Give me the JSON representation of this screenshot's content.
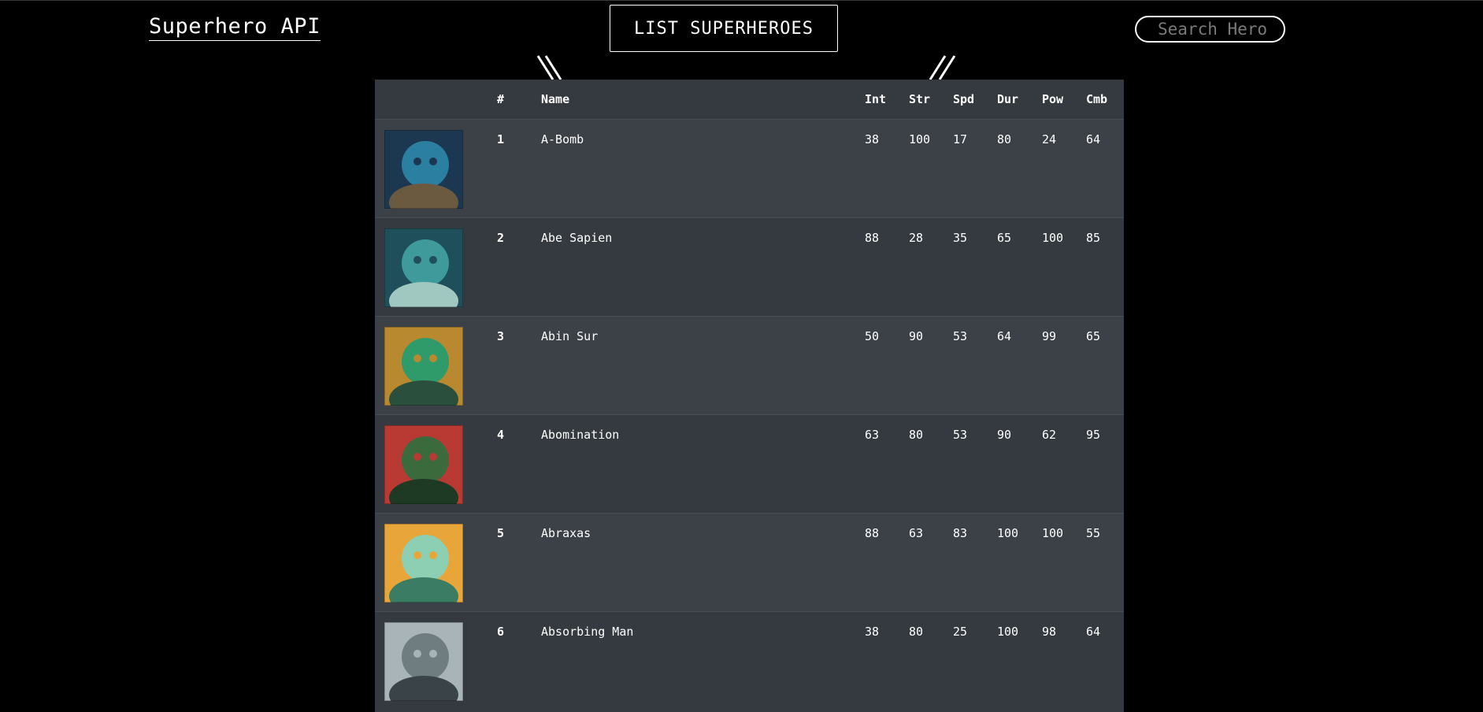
{
  "header": {
    "brand": "Superhero API",
    "list_button": "LIST SUPERHEROES",
    "search_placeholder": "Search Hero"
  },
  "table": {
    "columns": [
      "",
      "#",
      "Name",
      "Int",
      "Str",
      "Spd",
      "Dur",
      "Pow",
      "Cmb"
    ],
    "rows": [
      {
        "rank": "1",
        "name": "A-Bomb",
        "int": "38",
        "str": "100",
        "spd": "17",
        "dur": "80",
        "pow": "24",
        "cmb": "64",
        "palette": [
          "#2b7fa0",
          "#1c3850",
          "#6b5a40"
        ]
      },
      {
        "rank": "2",
        "name": "Abe Sapien",
        "int": "88",
        "str": "28",
        "spd": "35",
        "dur": "65",
        "pow": "100",
        "cmb": "85",
        "palette": [
          "#3f9a9c",
          "#1e4f5a",
          "#a0c8c0"
        ]
      },
      {
        "rank": "3",
        "name": "Abin Sur",
        "int": "50",
        "str": "90",
        "spd": "53",
        "dur": "64",
        "pow": "99",
        "cmb": "65",
        "palette": [
          "#2f9b6a",
          "#b8892f",
          "#2a4f3c"
        ]
      },
      {
        "rank": "4",
        "name": "Abomination",
        "int": "63",
        "str": "80",
        "spd": "53",
        "dur": "90",
        "pow": "62",
        "cmb": "95",
        "palette": [
          "#3b6b3c",
          "#b83a32",
          "#1f3a24"
        ]
      },
      {
        "rank": "5",
        "name": "Abraxas",
        "int": "88",
        "str": "63",
        "spd": "83",
        "dur": "100",
        "pow": "100",
        "cmb": "55",
        "palette": [
          "#8ccfb2",
          "#e8a63a",
          "#3a7d64"
        ]
      },
      {
        "rank": "6",
        "name": "Absorbing Man",
        "int": "38",
        "str": "80",
        "spd": "25",
        "dur": "100",
        "pow": "98",
        "cmb": "64",
        "palette": [
          "#6f7c80",
          "#a8b4b8",
          "#3a4448"
        ]
      }
    ]
  }
}
